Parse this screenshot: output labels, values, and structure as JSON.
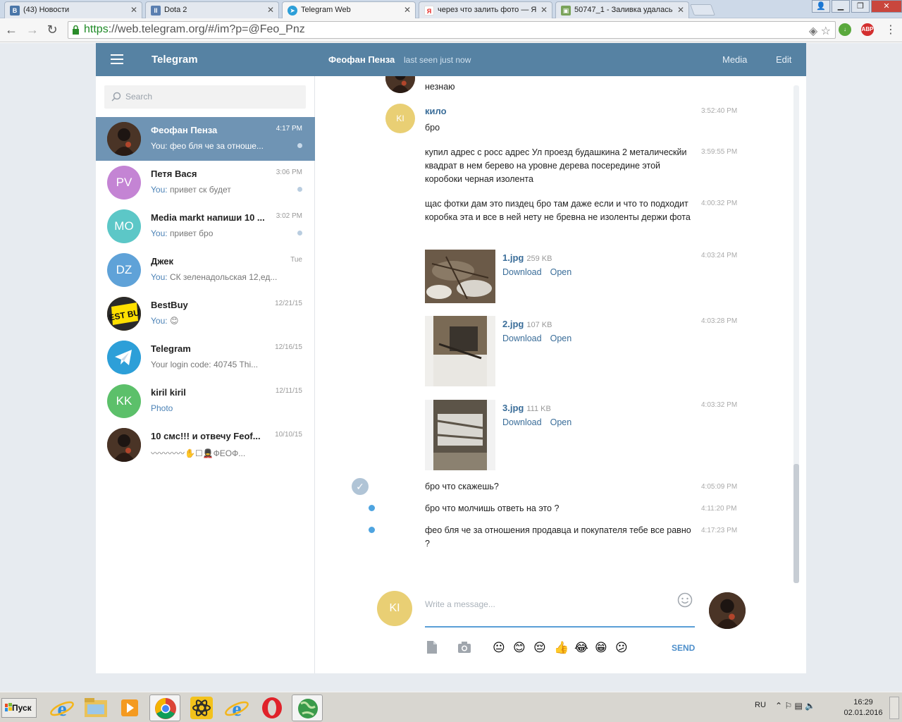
{
  "browser": {
    "tabs": [
      {
        "title": "(43) Новости",
        "favicon": "vk-icon"
      },
      {
        "title": "Dota 2",
        "favicon": "pause-icon"
      },
      {
        "title": "Telegram Web",
        "favicon": "telegram-icon"
      },
      {
        "title": "через что залить фото — Я",
        "favicon": "yandex-icon"
      },
      {
        "title": "50747_1 - Заливка удалась",
        "favicon": "image-host-icon"
      }
    ],
    "url_scheme": "https",
    "url_rest": "://web.telegram.org/#/im?p=@Feo_Pnz",
    "abp_label": "ABP"
  },
  "header": {
    "title": "Telegram",
    "peer_name": "Феофан Пенза",
    "peer_status": "last seen just now",
    "media_label": "Media",
    "edit_label": "Edit"
  },
  "sidebar": {
    "search_placeholder": "Search",
    "you_prefix": "You:",
    "dialogs": [
      {
        "name": "Феофан Пенза",
        "time": "4:17 PM",
        "preview": "фео бля че за отноше...",
        "you": true
      },
      {
        "name": "Петя Вася",
        "time": "3:06 PM",
        "preview": "привет ск будет",
        "you": true,
        "initials": "PV",
        "color": "#c484d4"
      },
      {
        "name": "Media markt напиши 10 ...",
        "time": "3:02 PM",
        "preview": "привет бро",
        "you": true,
        "initials": "MO",
        "color": "#5cc7c7"
      },
      {
        "name": "Джек",
        "time": "Tue",
        "preview": "СК зеленадольская 12,ед...",
        "you": true,
        "initials": "DZ",
        "color": "#5fa2d8"
      },
      {
        "name": "BestBuy",
        "time": "12/21/15",
        "preview": "😊",
        "you": true
      },
      {
        "name": "Telegram",
        "time": "12/16/15",
        "preview": "Your login code: 40745 Thi...",
        "you": false
      },
      {
        "name": "kiril kiril",
        "time": "12/11/15",
        "preview": "Photo",
        "you": false,
        "initials": "KK",
        "color": "#5cc06a"
      },
      {
        "name": "10 смс!!! и отвечу Feof...",
        "time": "10/10/15",
        "preview": "〰〰〰〰✋☐💂ФЕОФ...",
        "you": false
      }
    ]
  },
  "messages": {
    "first_text": "незнаю",
    "author": "кило",
    "author_initials": "KI",
    "download_label": "Download",
    "open_label": "Open",
    "items": [
      {
        "text": "бро",
        "time": "3:52:40 PM"
      },
      {
        "text": "купил адрес с росс адрес Ул проезд будашкина 2 металическйи квадрат  в нем берево на уровне дерева посередине этой коробоки черная изолента",
        "time": "3:59:55 PM"
      },
      {
        "text": "щас фотки дам это пиздец бро там даже если и что то подходит коробка эта и все в ней нету не бревна не изоленты держи фота",
        "time": "4:00:32 PM"
      }
    ],
    "files": [
      {
        "name": "1.jpg",
        "size": "259 KB",
        "time": "4:03:24 PM"
      },
      {
        "name": "2.jpg",
        "size": "107 KB",
        "time": "4:03:28 PM"
      },
      {
        "name": "3.jpg",
        "size": "111 KB",
        "time": "4:03:32 PM"
      }
    ],
    "outgoing": [
      {
        "text": "бро что скажешь?",
        "time": "4:05:09 PM"
      },
      {
        "text": "бро что молчишь ответь на это ?",
        "time": "4:11:20 PM"
      },
      {
        "text": "фео бля че за отношения продавца и покупателя тебе все равно ?",
        "time": "4:17:23 PM"
      }
    ]
  },
  "composer": {
    "placeholder": "Write a message...",
    "send_label": "SEND",
    "emojis": [
      "😐",
      "😊",
      "😔",
      "👍",
      "😂",
      "😁",
      "😕"
    ]
  },
  "taskbar": {
    "start_label": "Пуск",
    "lang": "RU",
    "time": "16:29",
    "date": "02.01.2016"
  },
  "colors": {
    "header": "#5682a3",
    "active_dialog": "#6f94b4",
    "link": "#3a6d99",
    "accent": "#4e8fcb"
  }
}
